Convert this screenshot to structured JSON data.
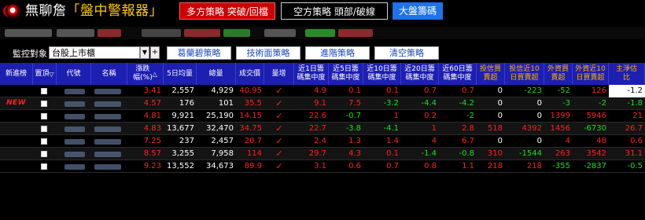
{
  "app": {
    "title_main": "無聊詹",
    "title_quote": "「盤中警報器」",
    "btn_long": "多方策略 突破/回檔",
    "btn_short": "空方策略 頭部/破線",
    "btn_market": "大盤籌碼"
  },
  "controls": {
    "monitor_label": "監控對象",
    "monitor_value": "台股上市櫃",
    "btn_strategies": [
      "葛蘭碧策略",
      "技術面策略",
      "進階策略",
      "清空策略"
    ]
  },
  "table": {
    "headers": [
      "新進榜",
      "置頂",
      "代號",
      "名稱",
      "漲跌\n幅(%)",
      "5日均量",
      "總量",
      "成交價",
      "量增",
      "近1日籌\n碼集中度",
      "近5日籌\n碼集中度",
      "近10日籌\n碼集中度",
      "近20日籌\n碼集中度",
      "近60日籌\n碼集中度",
      "投信買\n賣超",
      "投信近10\n日買賣超",
      "外資買\n賣超",
      "外資近10\n日買賣超",
      "主淨估\n比"
    ],
    "new_badge": "NEW",
    "check_mark": "✓",
    "rows": [
      {
        "new": false,
        "chg": "3.41",
        "vol5": "2,557",
        "vol": "4,929",
        "price": "40.95",
        "c1": "4.9",
        "c5": "0.1",
        "c10": "0.1",
        "c20": "0.7",
        "c60": "0.7",
        "it": "0",
        "it10": "-223",
        "fi": "-52",
        "fi10": "126",
        "ratio": "-1.2"
      },
      {
        "new": true,
        "chg": "4.57",
        "vol5": "176",
        "vol": "101",
        "price": "35.5",
        "c1": "9.1",
        "c5": "7.5",
        "c10": "-3.2",
        "c20": "-4.4",
        "c60": "-4.2",
        "it": "0",
        "it10": "0",
        "fi": "-3",
        "fi10": "-2",
        "ratio": "-1.8"
      },
      {
        "new": false,
        "chg": "4.81",
        "vol5": "9,921",
        "vol": "25,190",
        "price": "14.15",
        "c1": "22.6",
        "c5": "-0.7",
        "c10": "1",
        "c20": "0.2",
        "c60": "-2",
        "it": "0",
        "it10": "0",
        "fi": "1399",
        "fi10": "5946",
        "ratio": "21"
      },
      {
        "new": false,
        "chg": "4.83",
        "vol5": "13,677",
        "vol": "32,470",
        "price": "34.75",
        "c1": "22.7",
        "c5": "-3.8",
        "c10": "-4.1",
        "c20": "1",
        "c60": "2.8",
        "it": "518",
        "it10": "4392",
        "fi": "1456",
        "fi10": "-6730",
        "ratio": "26.7"
      },
      {
        "new": false,
        "chg": "7.25",
        "vol5": "237",
        "vol": "2,457",
        "price": "20.7",
        "c1": "2.4",
        "c5": "1.3",
        "c10": "1.4",
        "c20": "4",
        "c60": "6.7",
        "it": "0",
        "it10": "0",
        "fi": "4",
        "fi10": "48",
        "ratio": "0.6"
      },
      {
        "new": false,
        "chg": "8.57",
        "vol5": "3,255",
        "vol": "7,958",
        "price": "114",
        "c1": "29.7",
        "c5": "4.3",
        "c10": "0.1",
        "c20": "-1.4",
        "c60": "-0.8",
        "it": "310",
        "it10": "-1544",
        "fi": "263",
        "fi10": "3542",
        "ratio": "31.1"
      },
      {
        "new": false,
        "chg": "9.23",
        "vol5": "13,552",
        "vol": "34,673",
        "price": "89.9",
        "c1": "3.1",
        "c5": "0.6",
        "c10": "0.7",
        "c20": "0.8",
        "c60": "1.1",
        "it": "218",
        "it10": "218",
        "fi": "-355",
        "fi10": "-2837",
        "ratio": "-0.5"
      }
    ]
  },
  "colors": {
    "header_bg": "#1d1fb1",
    "up": "#ff2020",
    "down": "#18e018",
    "btn_red": "#cc0000",
    "btn_blue": "#1e73e8",
    "title_gold": "#ffcc00"
  }
}
